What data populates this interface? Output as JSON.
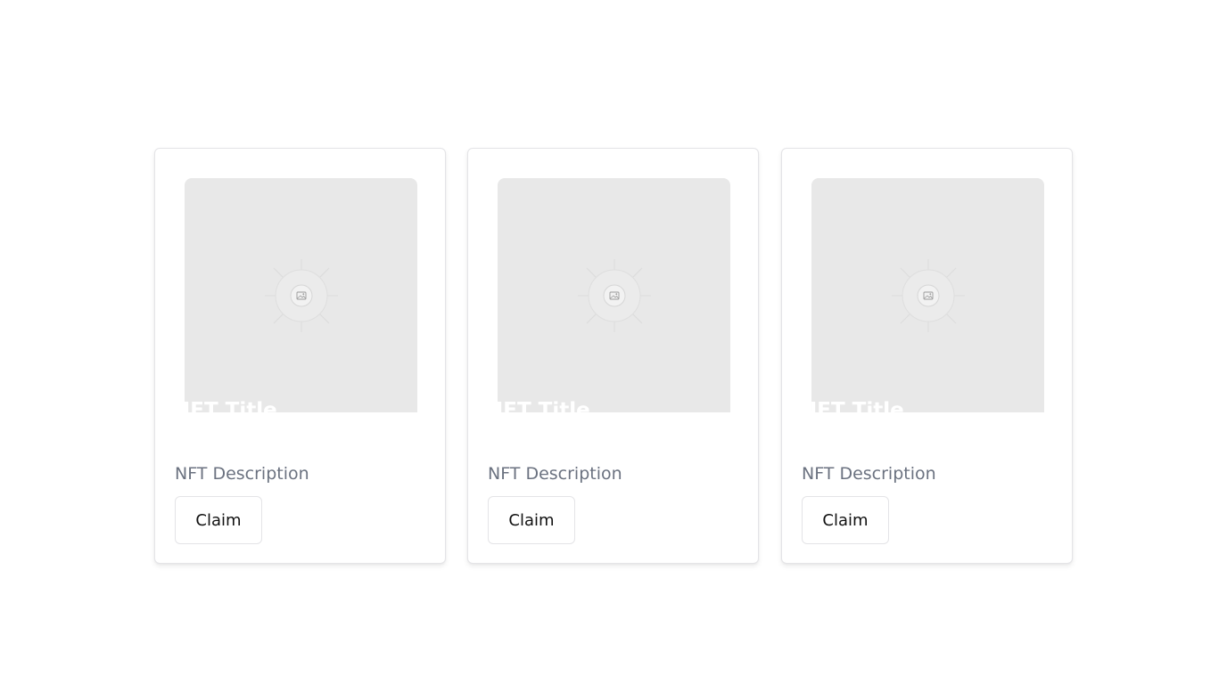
{
  "cards": [
    {
      "title": "NFT Title",
      "description": "NFT Description",
      "button_label": "Claim",
      "image_icon": "image-placeholder-icon"
    },
    {
      "title": "NFT Title",
      "description": "NFT Description",
      "button_label": "Claim",
      "image_icon": "image-placeholder-icon"
    },
    {
      "title": "NFT Title",
      "description": "NFT Description",
      "button_label": "Claim",
      "image_icon": "image-placeholder-icon"
    }
  ],
  "colors": {
    "placeholder_bg": "#e8e8e8",
    "description_text": "#6b7280",
    "card_border": "#e4e4e7",
    "title_text": "#ffffff"
  }
}
